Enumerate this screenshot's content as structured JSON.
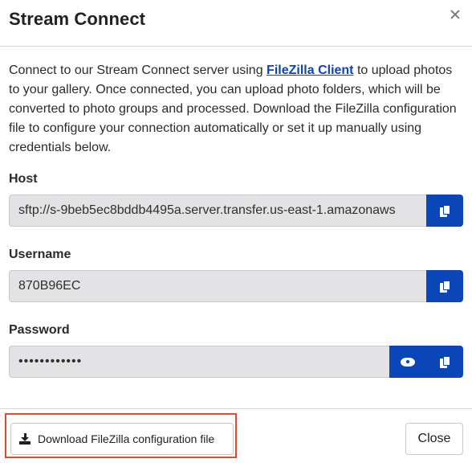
{
  "dialog": {
    "title": "Stream Connect",
    "close_icon": "close-icon"
  },
  "description": {
    "text_before_link": "Connect to our Stream Connect server using ",
    "link_text": "FileZilla Client",
    "text_after_link": " to upload photos to your gallery. Once connected, you can upload photo folders, which will be converted to photo groups and processed. Download the FileZilla configuration file to configure your connection automatically or set it up manually using credentials below."
  },
  "fields": {
    "host": {
      "label": "Host",
      "value": "sftp://s-9beb5ec8bddb4495a.server.transfer.us-east-1.amazonaws",
      "copy_icon": "copy-icon"
    },
    "username": {
      "label": "Username",
      "value": "870B96EC",
      "copy_icon": "copy-icon"
    },
    "password": {
      "label": "Password",
      "value": "••••••••••••",
      "show_icon": "eye-icon",
      "copy_icon": "copy-icon"
    }
  },
  "footer": {
    "download_label": "Download FileZilla configuration file",
    "download_icon": "download-icon",
    "close_label": "Close"
  },
  "colors": {
    "accent": "#0a46b8",
    "highlight_border": "#e04a2f",
    "input_bg": "#e3e3e5"
  }
}
